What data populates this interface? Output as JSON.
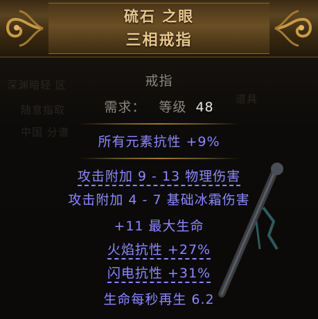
{
  "header": {
    "name": "硫石 之眼",
    "base_type": "三相戒指"
  },
  "background_text": {
    "line1": "深渊暗轻 区",
    "line2": "随意指取",
    "line3": "中国 分谱",
    "right": "道具"
  },
  "item": {
    "class": "戒指",
    "requirements_label": "需求：",
    "level_label": "等级",
    "level_value": "48",
    "implicit": "所有元素抗性 +9%",
    "mods": [
      "攻击附加 9 - 13 物理伤害",
      "攻击附加 4 - 7 基础冰霜伤害",
      "+11 最大生命",
      "火焰抗性 +27%",
      "闪电抗性 +31%",
      "生命每秒再生 6.2"
    ]
  },
  "colors": {
    "header_text": "#e9c68e",
    "magic": "#8c88ff",
    "label": "#8a8680",
    "value": "#e6e6e6"
  },
  "icons": {
    "left_ornament": "gold-scroll-ornament-icon",
    "right_ornament": "gold-scroll-ornament-icon",
    "staff": "staff-illustration"
  }
}
